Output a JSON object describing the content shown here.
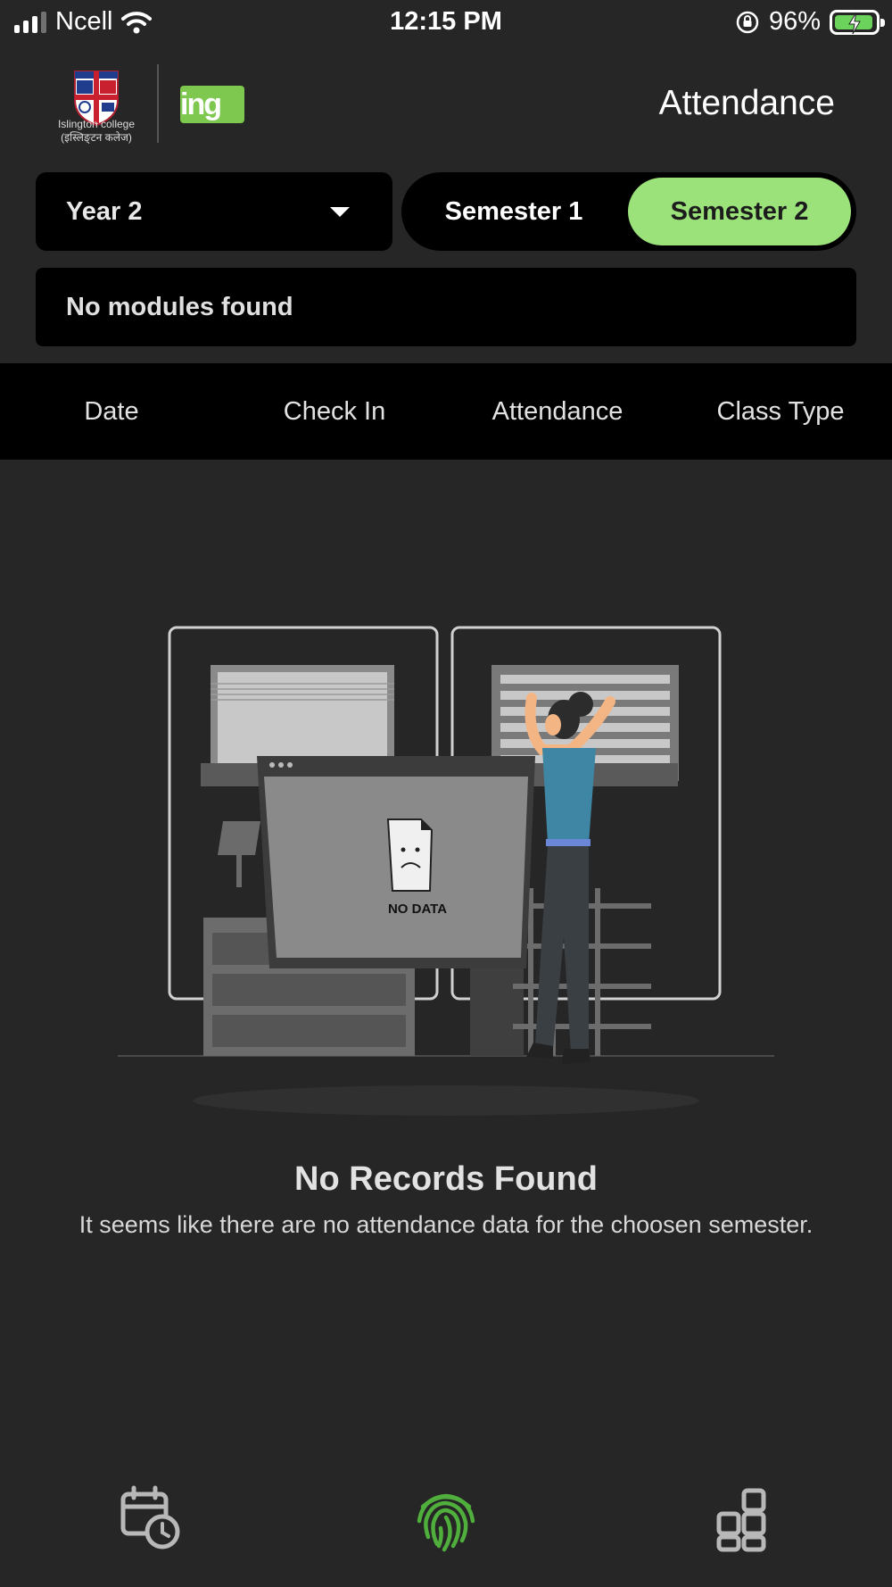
{
  "status_bar": {
    "carrier": "Ncell",
    "time": "12:15 PM",
    "battery_percent": "96%",
    "battery_level": 0.96,
    "signal_bars": 3
  },
  "header": {
    "college_name_line1": "Islington college",
    "college_name_line2": "(इस्लिङ्टन कलेज)",
    "partner_logo": "ing",
    "title": "Attendance"
  },
  "filters": {
    "year": {
      "selected": "Year 2",
      "icon": "caret-down-icon"
    },
    "semesters": [
      {
        "label": "Semester 1",
        "active": false
      },
      {
        "label": "Semester 2",
        "active": true
      }
    ],
    "modules_text": "No modules found"
  },
  "table": {
    "columns": [
      "Date",
      "Check In",
      "Attendance",
      "Class Type"
    ]
  },
  "empty_state": {
    "illustration_text": "NO DATA",
    "title": "No Records Found",
    "description": "It seems like there are no attendance data for the choosen semester."
  },
  "bottom_nav": [
    {
      "icon": "calendar-clock-icon",
      "active": false
    },
    {
      "icon": "fingerprint-icon",
      "active": true
    },
    {
      "icon": "grid-icon",
      "active": false
    }
  ],
  "colors": {
    "background": "#262626",
    "accent": "#9be27a",
    "active_nav": "#4fae3c",
    "inactive_nav": "#b8b8b8"
  }
}
